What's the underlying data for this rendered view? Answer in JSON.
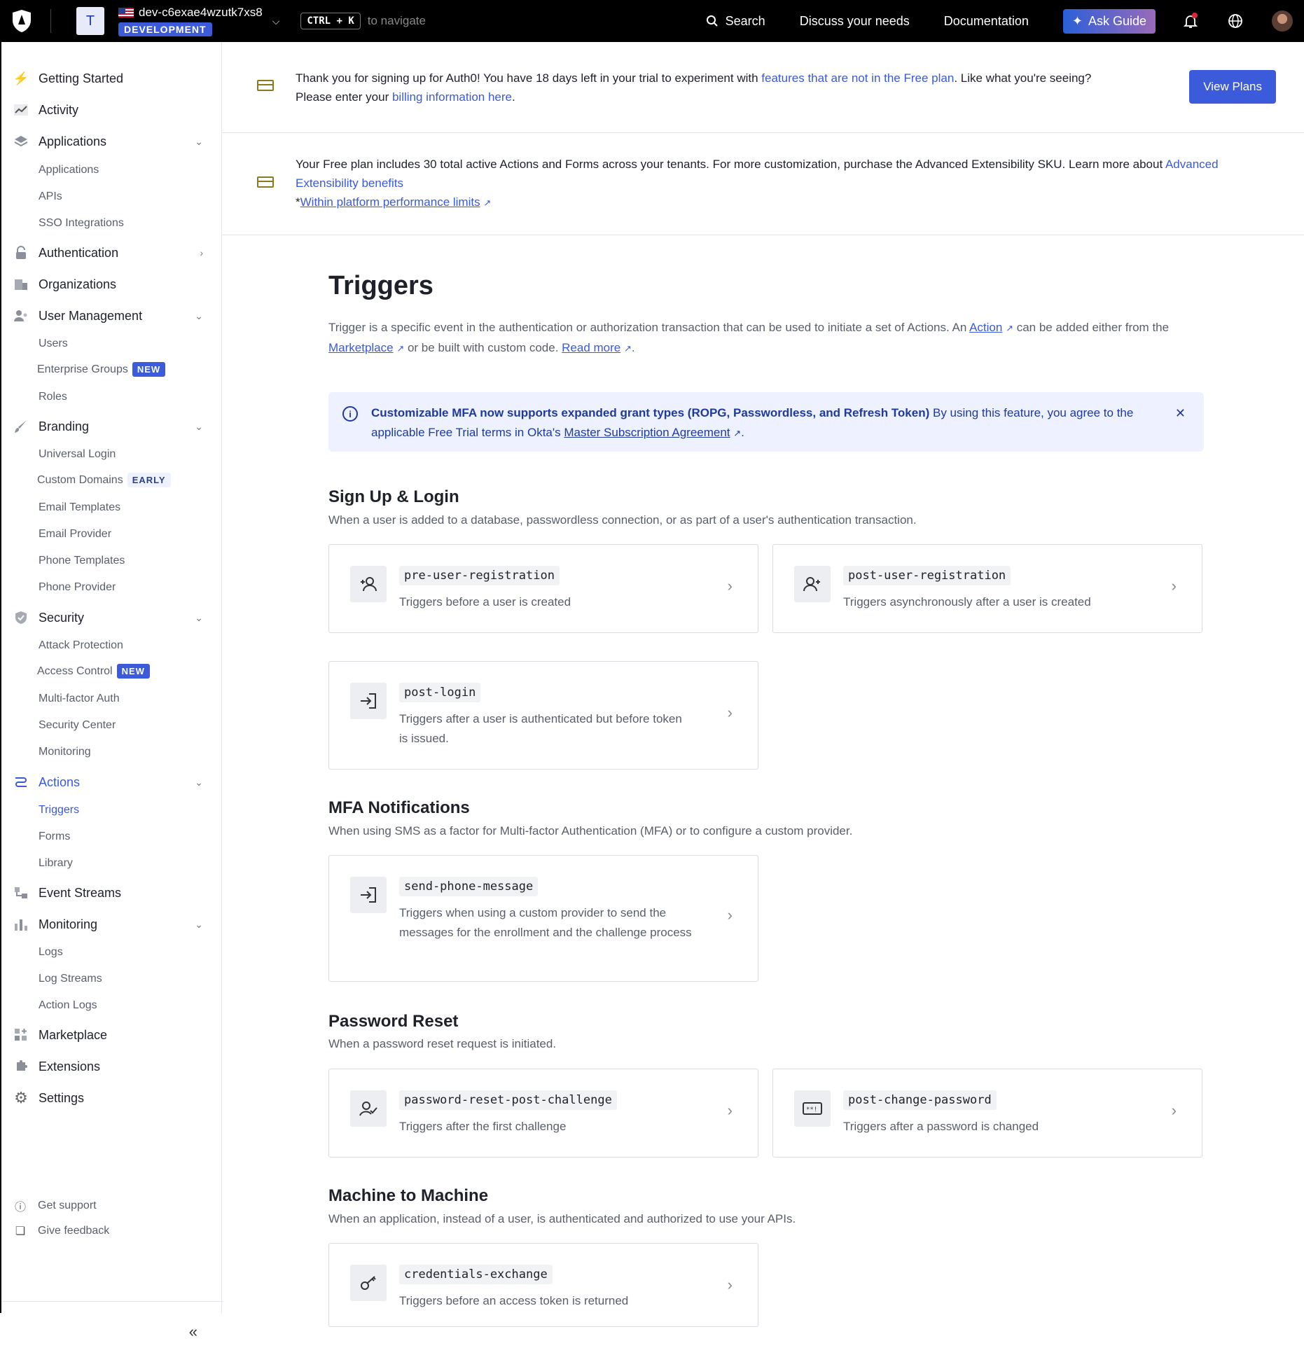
{
  "topbar": {
    "tenant_initial": "T",
    "tenant_name": "dev-c6exae4wzutk7xs8",
    "env_badge": "DEVELOPMENT",
    "shortcut": "CTRL + K",
    "nav_hint": "to navigate",
    "search_label": "Search",
    "discuss_label": "Discuss your needs",
    "docs_label": "Documentation",
    "ask_label": "Ask Guide"
  },
  "sidebar": {
    "getting_started": "Getting Started",
    "activity": "Activity",
    "applications": "Applications",
    "applications_sub": [
      "Applications",
      "APIs",
      "SSO Integrations"
    ],
    "authentication": "Authentication",
    "organizations": "Organizations",
    "user_management": "User Management",
    "users": "Users",
    "enterprise_groups": "Enterprise Groups",
    "roles": "Roles",
    "new_badge": "NEW",
    "early_badge": "EARLY",
    "branding": "Branding",
    "universal_login": "Universal Login",
    "custom_domains": "Custom Domains",
    "branding_sub": [
      "Email Templates",
      "Email Provider",
      "Phone Templates",
      "Phone Provider"
    ],
    "security": "Security",
    "attack_protection": "Attack Protection",
    "access_control": "Access Control",
    "security_sub": [
      "Multi-factor Auth",
      "Security Center",
      "Monitoring"
    ],
    "actions": "Actions",
    "actions_sub": [
      "Triggers",
      "Forms",
      "Library"
    ],
    "event_streams": "Event Streams",
    "monitoring": "Monitoring",
    "monitoring_sub": [
      "Logs",
      "Log Streams",
      "Action Logs"
    ],
    "marketplace": "Marketplace",
    "extensions": "Extensions",
    "settings": "Settings",
    "get_support": "Get support",
    "give_feedback": "Give feedback",
    "collapse": "«"
  },
  "notices": {
    "trial_a": "Thank you for signing up for Auth0! You have 18 days left in your trial to experiment with ",
    "trial_link": "features that are not in the Free plan",
    "trial_b": ". Like what you're seeing? Please enter your ",
    "billing_link": "billing information here",
    "trial_end": ".",
    "view_plans": "View Plans",
    "free_a": "Your Free plan includes 30 total active Actions and Forms across your tenants. For more customization, purchase the Advanced Extensibility SKU. Learn more about ",
    "free_link": "Advanced Extensibility benefits",
    "star": "*",
    "perf_link": "Within platform performance limits"
  },
  "page": {
    "title": "Triggers",
    "intro_a": "Trigger is a specific event in the authentication or authorization transaction that can be used to initiate a set of Actions. An ",
    "action_link": "Action",
    "intro_b": " can be added either from the ",
    "marketplace_link": "Marketplace",
    "intro_c": " or be built with custom code. ",
    "read_more": "Read more",
    "intro_end": "."
  },
  "banner": {
    "bold": "Customizable MFA now supports expanded grant types (ROPG, Passwordless, and Refresh Token)",
    "text": " By using this feature, you agree to the applicable Free Trial terms in Okta's ",
    "link": "Master Subscription Agreement",
    "end": "."
  },
  "sections": {
    "signup": {
      "title": "Sign Up & Login",
      "desc": "When a user is added to a database, passwordless connection, or as part of a user's authentication transaction.",
      "cards": [
        {
          "name": "pre-user-registration",
          "desc": "Triggers before a user is created"
        },
        {
          "name": "post-user-registration",
          "desc": "Triggers asynchronously after a user is created"
        },
        {
          "name": "post-login",
          "desc": "Triggers after a user is authenticated but before token is issued."
        }
      ]
    },
    "mfa": {
      "title": "MFA Notifications",
      "desc": "When using SMS as a factor for Multi-factor Authentication (MFA) or to configure a custom provider.",
      "cards": [
        {
          "name": "send-phone-message",
          "desc": "Triggers when using a custom provider to send the messages for the enrollment and the challenge process"
        }
      ]
    },
    "reset": {
      "title": "Password Reset",
      "desc": "When a password reset request is initiated.",
      "cards": [
        {
          "name": "password-reset-post-challenge",
          "desc": "Triggers after the first challenge"
        },
        {
          "name": "post-change-password",
          "desc": "Triggers after a password is changed"
        }
      ]
    },
    "m2m": {
      "title": "Machine to Machine",
      "desc": "When an application, instead of a user, is authenticated and authorized to use your APIs.",
      "cards": [
        {
          "name": "credentials-exchange",
          "desc": "Triggers before an access token is returned"
        }
      ]
    }
  },
  "colors": {
    "accent": "#3b5bdb",
    "link": "#3a5ad9",
    "banner_bg": "#eef1ff"
  }
}
